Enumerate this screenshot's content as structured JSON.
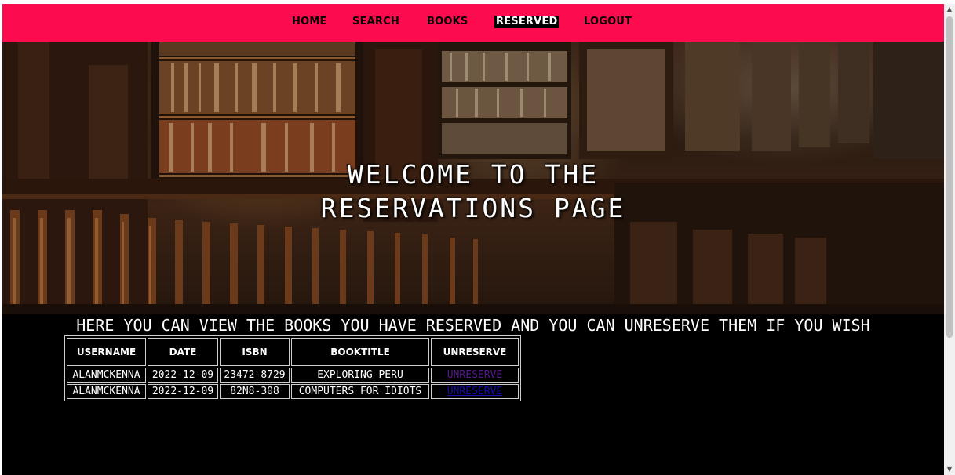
{
  "nav": {
    "items": [
      {
        "label": "HOME"
      },
      {
        "label": "SEARCH"
      },
      {
        "label": "BOOKS"
      },
      {
        "label": "RESERVED"
      },
      {
        "label": "LOGOUT"
      }
    ],
    "active": "RESERVED",
    "background": "#fc0b4e"
  },
  "hero": {
    "title_line1": "WELCOME TO THE",
    "title_line2": "RESERVATIONS PAGE"
  },
  "subtitle": "HERE YOU CAN VIEW THE BOOKS YOU HAVE RESERVED AND YOU CAN UNRESERVE THEM IF YOU WISH",
  "table": {
    "headers": [
      "USERNAME",
      "DATE",
      "ISBN",
      "BOOKTITLE",
      "UNRESERVE"
    ],
    "rows": [
      {
        "username": "ALANMCKENNA",
        "date": "2022-12-09",
        "isbn": "23472-8729",
        "title": "EXPLORING PERU",
        "action": "UNRESERVE",
        "visited": true
      },
      {
        "username": "ALANMCKENNA",
        "date": "2022-12-09",
        "isbn": "82N8-308",
        "title": "COMPUTERS FOR IDIOTS",
        "action": "UNRESERVE",
        "visited": false
      }
    ]
  },
  "colors": {
    "page_background": "#000000",
    "link": "#1a0dab",
    "link_visited": "#551a8b"
  }
}
